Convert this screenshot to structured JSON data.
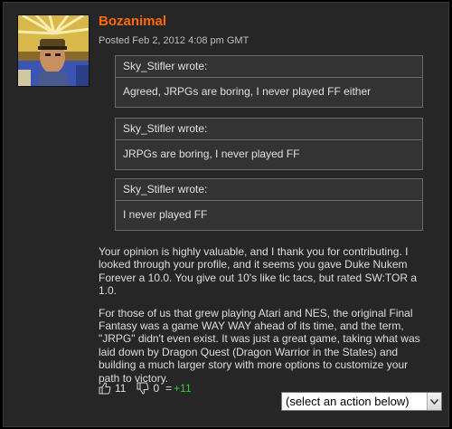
{
  "post": {
    "username": "Bozanimal",
    "posted": "Posted Feb 2, 2012 4:08 pm GMT",
    "quotes": [
      {
        "author_line": "Sky_Stifler wrote:",
        "text": "Agreed, JRPGs are boring, I never played FF either"
      },
      {
        "author_line": "Sky_Stifler wrote:",
        "text": "JRPGs are boring, I never played FF"
      },
      {
        "author_line": "Sky_Stifler wrote:",
        "text": "I never played FF"
      }
    ],
    "paragraphs": [
      "Your opinion is highly valuable, and I thank you for contributing. I looked through your profile, and it seems you gave Duke Nukem Forever a 10.0. You give out 10's like tic tacs, but rated SW:TOR a 1.0.",
      "For those of us that grew playing Atari and NES, the original Final Fantasy was a game WAY WAY ahead of its time, and the term, \"JRPG\" didn't even exist. It was just a great game, taking what was laid down by Dragon Quest (Dragon Warrior in the States) and building a much larger story with more options to customize your path to victory."
    ],
    "votes": {
      "up_icon": "thumbs-up-icon",
      "up_count": "11",
      "down_icon": "thumbs-down-icon",
      "down_count": "0",
      "equals": "=",
      "total": "+11",
      "total_color": "#33cc33"
    },
    "action_select": {
      "selected": "(select an action below)",
      "icon": "chevron-down-icon"
    }
  },
  "colors": {
    "background": "#262626",
    "username": "#ff6a00",
    "quote_bg": "#333333",
    "quote_border": "#6a6a6a"
  }
}
